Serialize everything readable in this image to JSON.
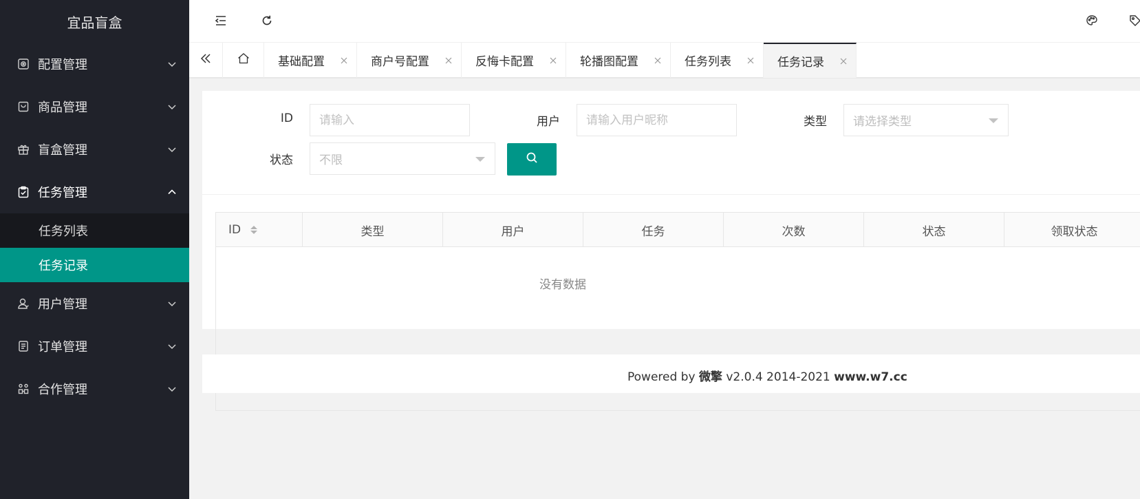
{
  "sidebar": {
    "logo": "宜品盲盒",
    "menu": [
      {
        "label": "配置管理",
        "icon": "settings-icon",
        "open": false
      },
      {
        "label": "商品管理",
        "icon": "product-icon",
        "open": false
      },
      {
        "label": "盲盒管理",
        "icon": "gift-icon",
        "open": false
      },
      {
        "label": "任务管理",
        "icon": "task-icon",
        "open": true
      },
      {
        "label": "用户管理",
        "icon": "user-icon",
        "open": false
      },
      {
        "label": "订单管理",
        "icon": "order-icon",
        "open": false
      },
      {
        "label": "合作管理",
        "icon": "partner-icon",
        "open": false
      }
    ],
    "submenu_task": [
      {
        "label": "任务列表",
        "active": false
      },
      {
        "label": "任务记录",
        "active": true
      }
    ],
    "bg_color": "#20222a",
    "active_color": "#009688"
  },
  "header": {
    "left_icons": [
      "menu-fold-icon",
      "refresh-icon"
    ],
    "right_icons": [
      "theme-palette-icon",
      "tag-icon"
    ]
  },
  "tabs": {
    "items": [
      {
        "label": "基础配置"
      },
      {
        "label": "商户号配置"
      },
      {
        "label": "反悔卡配置"
      },
      {
        "label": "轮播图配置"
      },
      {
        "label": "任务列表"
      },
      {
        "label": "任务记录",
        "active": true
      }
    ]
  },
  "filters": {
    "id_label": "ID",
    "id_placeholder": "请输入",
    "user_label": "用户",
    "user_placeholder": "请输入用户昵称",
    "type_label": "类型",
    "type_placeholder": "请选择类型",
    "status_label": "状态",
    "status_value": "不限"
  },
  "table": {
    "columns": [
      "ID",
      "类型",
      "用户",
      "任务",
      "次数",
      "状态",
      "领取状态"
    ],
    "rows": [],
    "empty_text": "没有数据"
  },
  "footer": {
    "prefix": "Powered by ",
    "brand": "微擎",
    "version": " v2.0.4 2014-2021 ",
    "site": "www.w7.cc"
  }
}
